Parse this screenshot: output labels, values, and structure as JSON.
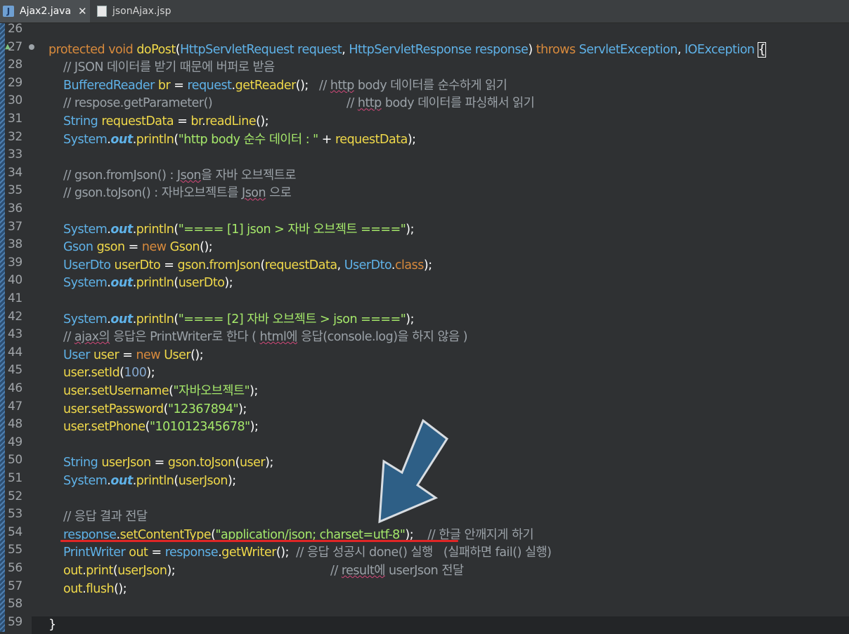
{
  "tabs": [
    {
      "label": "Ajax2.java",
      "icon": "java-file-icon",
      "active": true
    },
    {
      "label": "jsonAjax.jsp",
      "icon": "jsp-file-icon",
      "active": false
    }
  ],
  "line_numbers": [
    "26",
    "27",
    "28",
    "29",
    "30",
    "31",
    "32",
    "33",
    "34",
    "35",
    "36",
    "37",
    "38",
    "39",
    "40",
    "41",
    "42",
    "43",
    "44",
    "45",
    "46",
    "47",
    "48",
    "49",
    "50",
    "51",
    "52",
    "53",
    "54",
    "55",
    "56",
    "57",
    "58",
    "59"
  ],
  "code": {
    "l27": {
      "protected": "protected",
      "void": "void",
      "method": "doPost",
      "p1type": "HttpServletRequest",
      "p1": "request",
      "p2type": "HttpServletResponse",
      "p2": "response",
      "throws": "throws",
      "ex1": "ServletException",
      "ex2": "IOException"
    },
    "l28": "// JSON 데이터를 받기 때문에 버퍼로 받음",
    "l29": {
      "type": "BufferedReader",
      "var": "br",
      "obj": "request",
      "call": "getReader",
      "c_pre": "// ",
      "c_word": "http",
      "c_post": " body 데이터를 순수하게 읽기"
    },
    "l30": {
      "comment": "// respose.getParameter()",
      "c_pre": "// ",
      "c_word": "http",
      "c_post": " body 데이터를 파싱해서 읽기"
    },
    "l31": {
      "type": "String",
      "var": "requestData",
      "obj": "br",
      "call": "readLine"
    },
    "l32": {
      "cls": "System",
      "out": "out",
      "call": "println",
      "str": "\"http body 순수 데이터 : \"",
      "var": "requestData"
    },
    "l34": {
      "pre": "// gson.fromJson() : ",
      "word": "Json",
      "post": "을 자바 오브젝트로"
    },
    "l35": {
      "pre": "// gson.toJson() : 자바오브젝트를 ",
      "word": "Json",
      "post": " 으로"
    },
    "l37": {
      "cls": "System",
      "out": "out",
      "call": "println",
      "str": "\"==== [1] json > 자바 오브젝트 ====\""
    },
    "l38": {
      "type": "Gson",
      "var": "gson",
      "new": "new",
      "ctor": "Gson"
    },
    "l39": {
      "type": "UserDto",
      "var": "userDto",
      "obj": "gson",
      "call": "fromJson",
      "arg": "requestData",
      "cls": "UserDto",
      "kw": "class"
    },
    "l40": {
      "cls": "System",
      "out": "out",
      "call": "println",
      "arg": "userDto"
    },
    "l42": {
      "cls": "System",
      "out": "out",
      "call": "println",
      "str": "\"==== [2] 자바 오브젝트 > json ====\""
    },
    "l43": {
      "pre": "// ",
      "w1": "ajax의",
      "mid": " 응답은 PrintWriter로 한다 ( ",
      "w2": "html에",
      "post": " 응답(console.log)을 하지 않음 )"
    },
    "l44": {
      "type": "User",
      "var": "user",
      "new": "new",
      "ctor": "User"
    },
    "l45": {
      "obj": "user",
      "call": "setId",
      "num": "100"
    },
    "l46": {
      "obj": "user",
      "call": "setUsername",
      "str": "\"자바오브젝트\""
    },
    "l47": {
      "obj": "user",
      "call": "setPassword",
      "str": "\"12367894\""
    },
    "l48": {
      "obj": "user",
      "call": "setPhone",
      "str": "\"101012345678\""
    },
    "l50": {
      "type": "String",
      "var": "userJson",
      "obj": "gson",
      "call": "toJson",
      "arg": "user"
    },
    "l51": {
      "cls": "System",
      "out": "out",
      "call": "println",
      "arg": "userJson"
    },
    "l53": "// 응답 결과 전달",
    "l54": {
      "obj": "response",
      "call": "setContentType",
      "str": "\"application/json; charset=utf-8\"",
      "comment": "// 한글 안깨지게 하기"
    },
    "l55": {
      "type": "PrintWriter",
      "var": "out",
      "obj": "response",
      "call": "getWriter",
      "comment": "// 응답 성공시 done() 실행   (실패하면 fail() 실행)"
    },
    "l56": {
      "obj": "out",
      "call": "print",
      "arg": "userJson",
      "c_pre": "// ",
      "c_word": "result에",
      "c_post": " userJson 전달"
    },
    "l57": {
      "obj": "out",
      "call": "flush"
    },
    "l59": "}"
  },
  "colors": {
    "background": "#2f3133",
    "keyword": "#d88a3c",
    "type": "#5fb2e8",
    "method": "#f0d94a",
    "string": "#a5e86a",
    "comment": "#9ba2a8",
    "highlight_underline": "#e02626",
    "arrow": "#2e5f86"
  }
}
